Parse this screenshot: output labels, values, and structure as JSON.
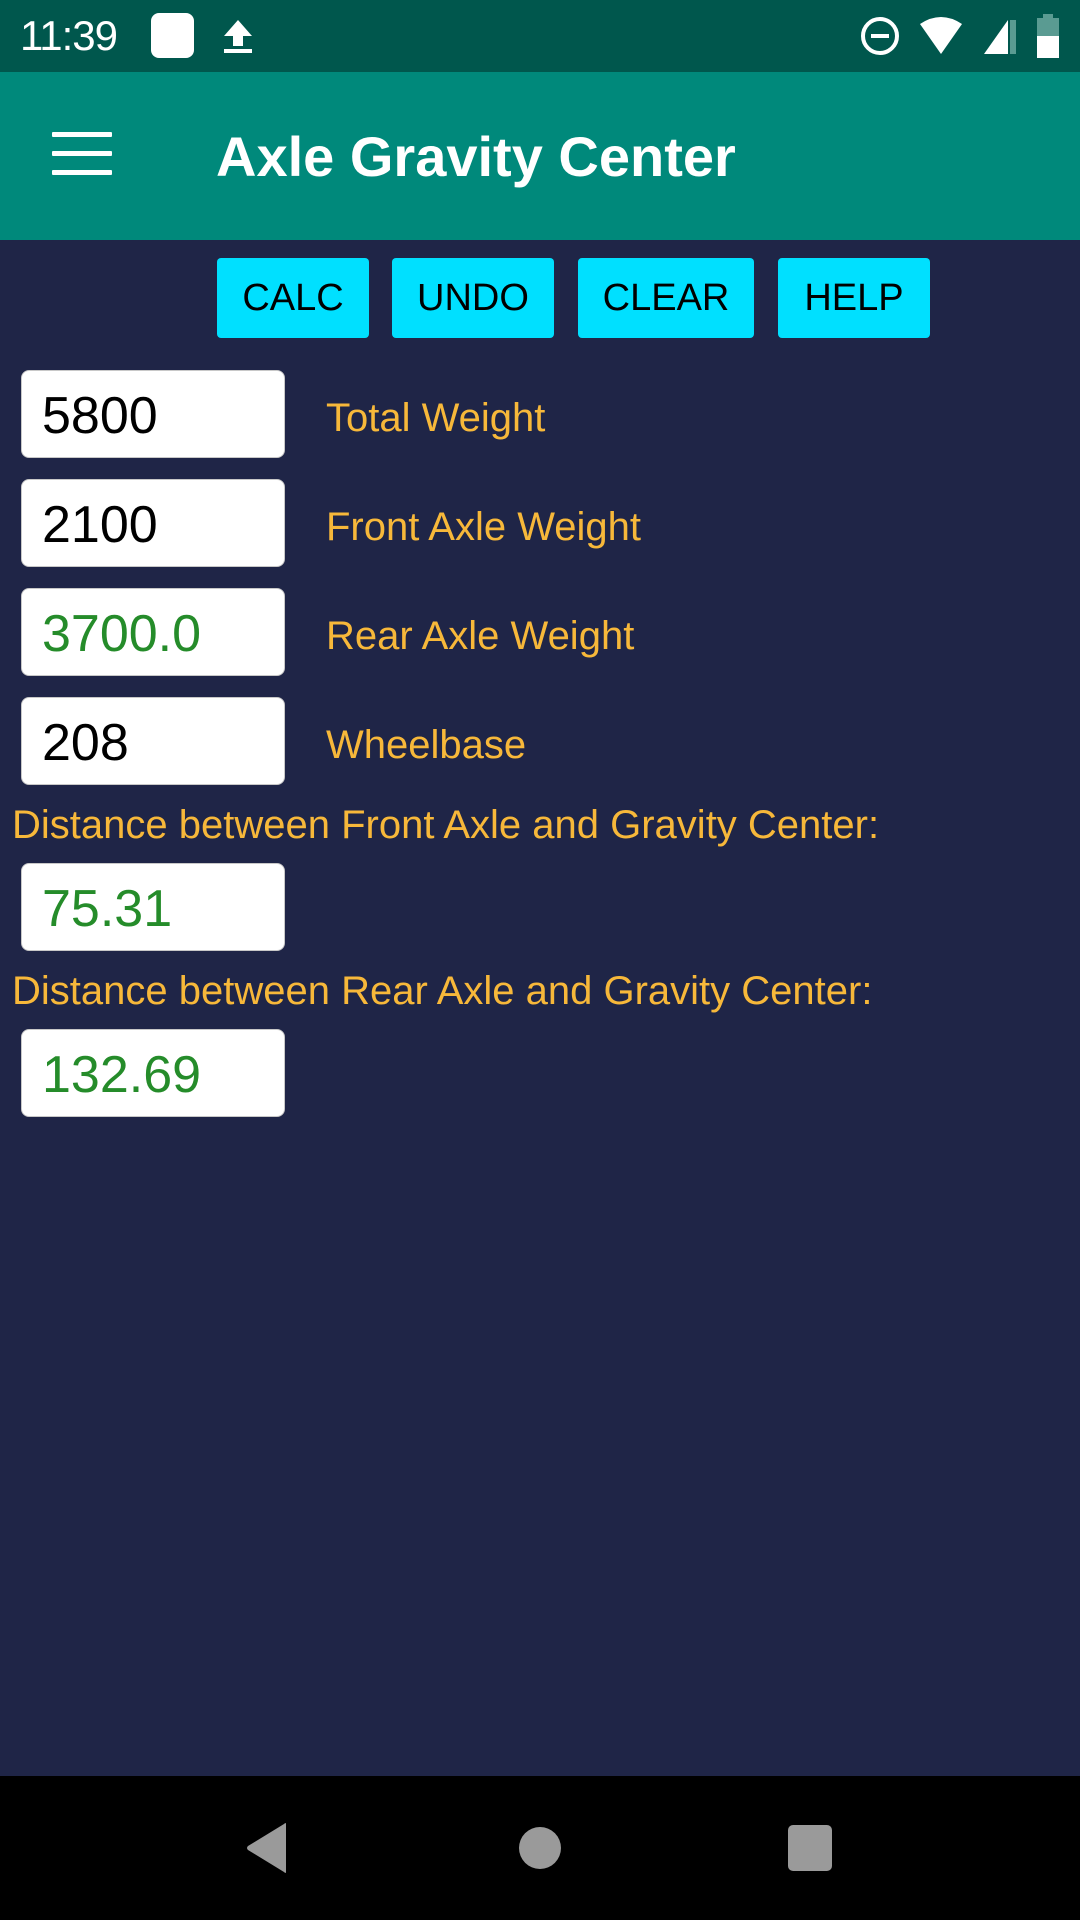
{
  "status_bar": {
    "time": "11:39",
    "left_icons": [
      "notification-square-icon",
      "upload-icon"
    ],
    "right_icons": [
      "do-not-disturb-icon",
      "wifi-icon",
      "cell-signal-icon",
      "battery-icon"
    ]
  },
  "app_bar": {
    "menu_icon": "hamburger-menu-icon",
    "title": "Axle Gravity Center",
    "color": "#00897b"
  },
  "toolbar": {
    "buttons": [
      {
        "label": "CALC"
      },
      {
        "label": "UNDO"
      },
      {
        "label": "CLEAR"
      },
      {
        "label": "HELP"
      }
    ],
    "button_color": "#00e0ff"
  },
  "fields": [
    {
      "value": "5800",
      "label": "Total Weight",
      "type": "input"
    },
    {
      "value": "2100",
      "label": "Front Axle Weight",
      "type": "input"
    },
    {
      "value": "3700.0",
      "label": "Rear Axle Weight",
      "type": "result"
    },
    {
      "value": "208",
      "label": "Wheelbase",
      "type": "input"
    }
  ],
  "results": [
    {
      "label": "Distance between Front Axle and Gravity Center:",
      "value": "75.31"
    },
    {
      "label": "Distance between Rear Axle and Gravity Center:",
      "value": "132.69"
    }
  ],
  "colors": {
    "background": "#1f2547",
    "label": "#f7b83a",
    "result_text": "#258c2a"
  },
  "nav_bar": {
    "buttons": [
      "back-icon",
      "home-icon",
      "recents-icon"
    ]
  }
}
